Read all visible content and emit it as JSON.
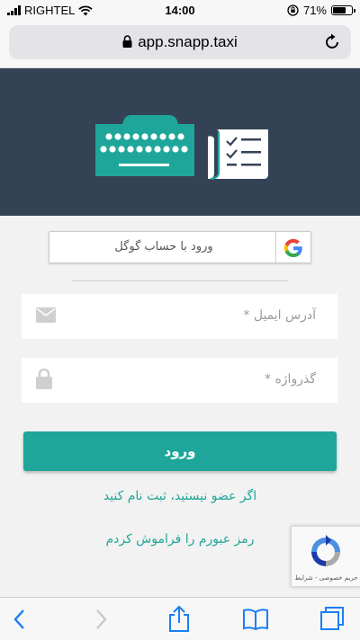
{
  "status_bar": {
    "carrier": "RIGHTEL",
    "time": "14:00",
    "battery_text": "71%",
    "battery_level": 0.71
  },
  "browser": {
    "url": "app.snapp.taxi"
  },
  "login": {
    "google_button_label": "ورود با حساب گوگل",
    "email_placeholder": "آدرس ایمیل *",
    "password_placeholder": "گذرواژه *",
    "submit_label": "ورود",
    "signup_link": "اگر عضو نیستید، ثبت نام کنید",
    "forgot_link": "رمز عبورم را فراموش کردم"
  },
  "recaptcha": {
    "terms_text": "حریم خصوصی - شرایط"
  },
  "colors": {
    "accent": "#1fa69a",
    "hero_background": "#344256"
  },
  "icons": [
    "signal-icon",
    "wifi-icon",
    "orientation-lock-icon",
    "battery-icon",
    "lock-icon",
    "reload-icon",
    "keyboard-icon",
    "checklist-icon",
    "google-icon",
    "mail-icon",
    "padlock-icon",
    "recaptcha-icon",
    "back-icon",
    "forward-icon",
    "share-icon",
    "bookmarks-icon",
    "tabs-icon"
  ]
}
